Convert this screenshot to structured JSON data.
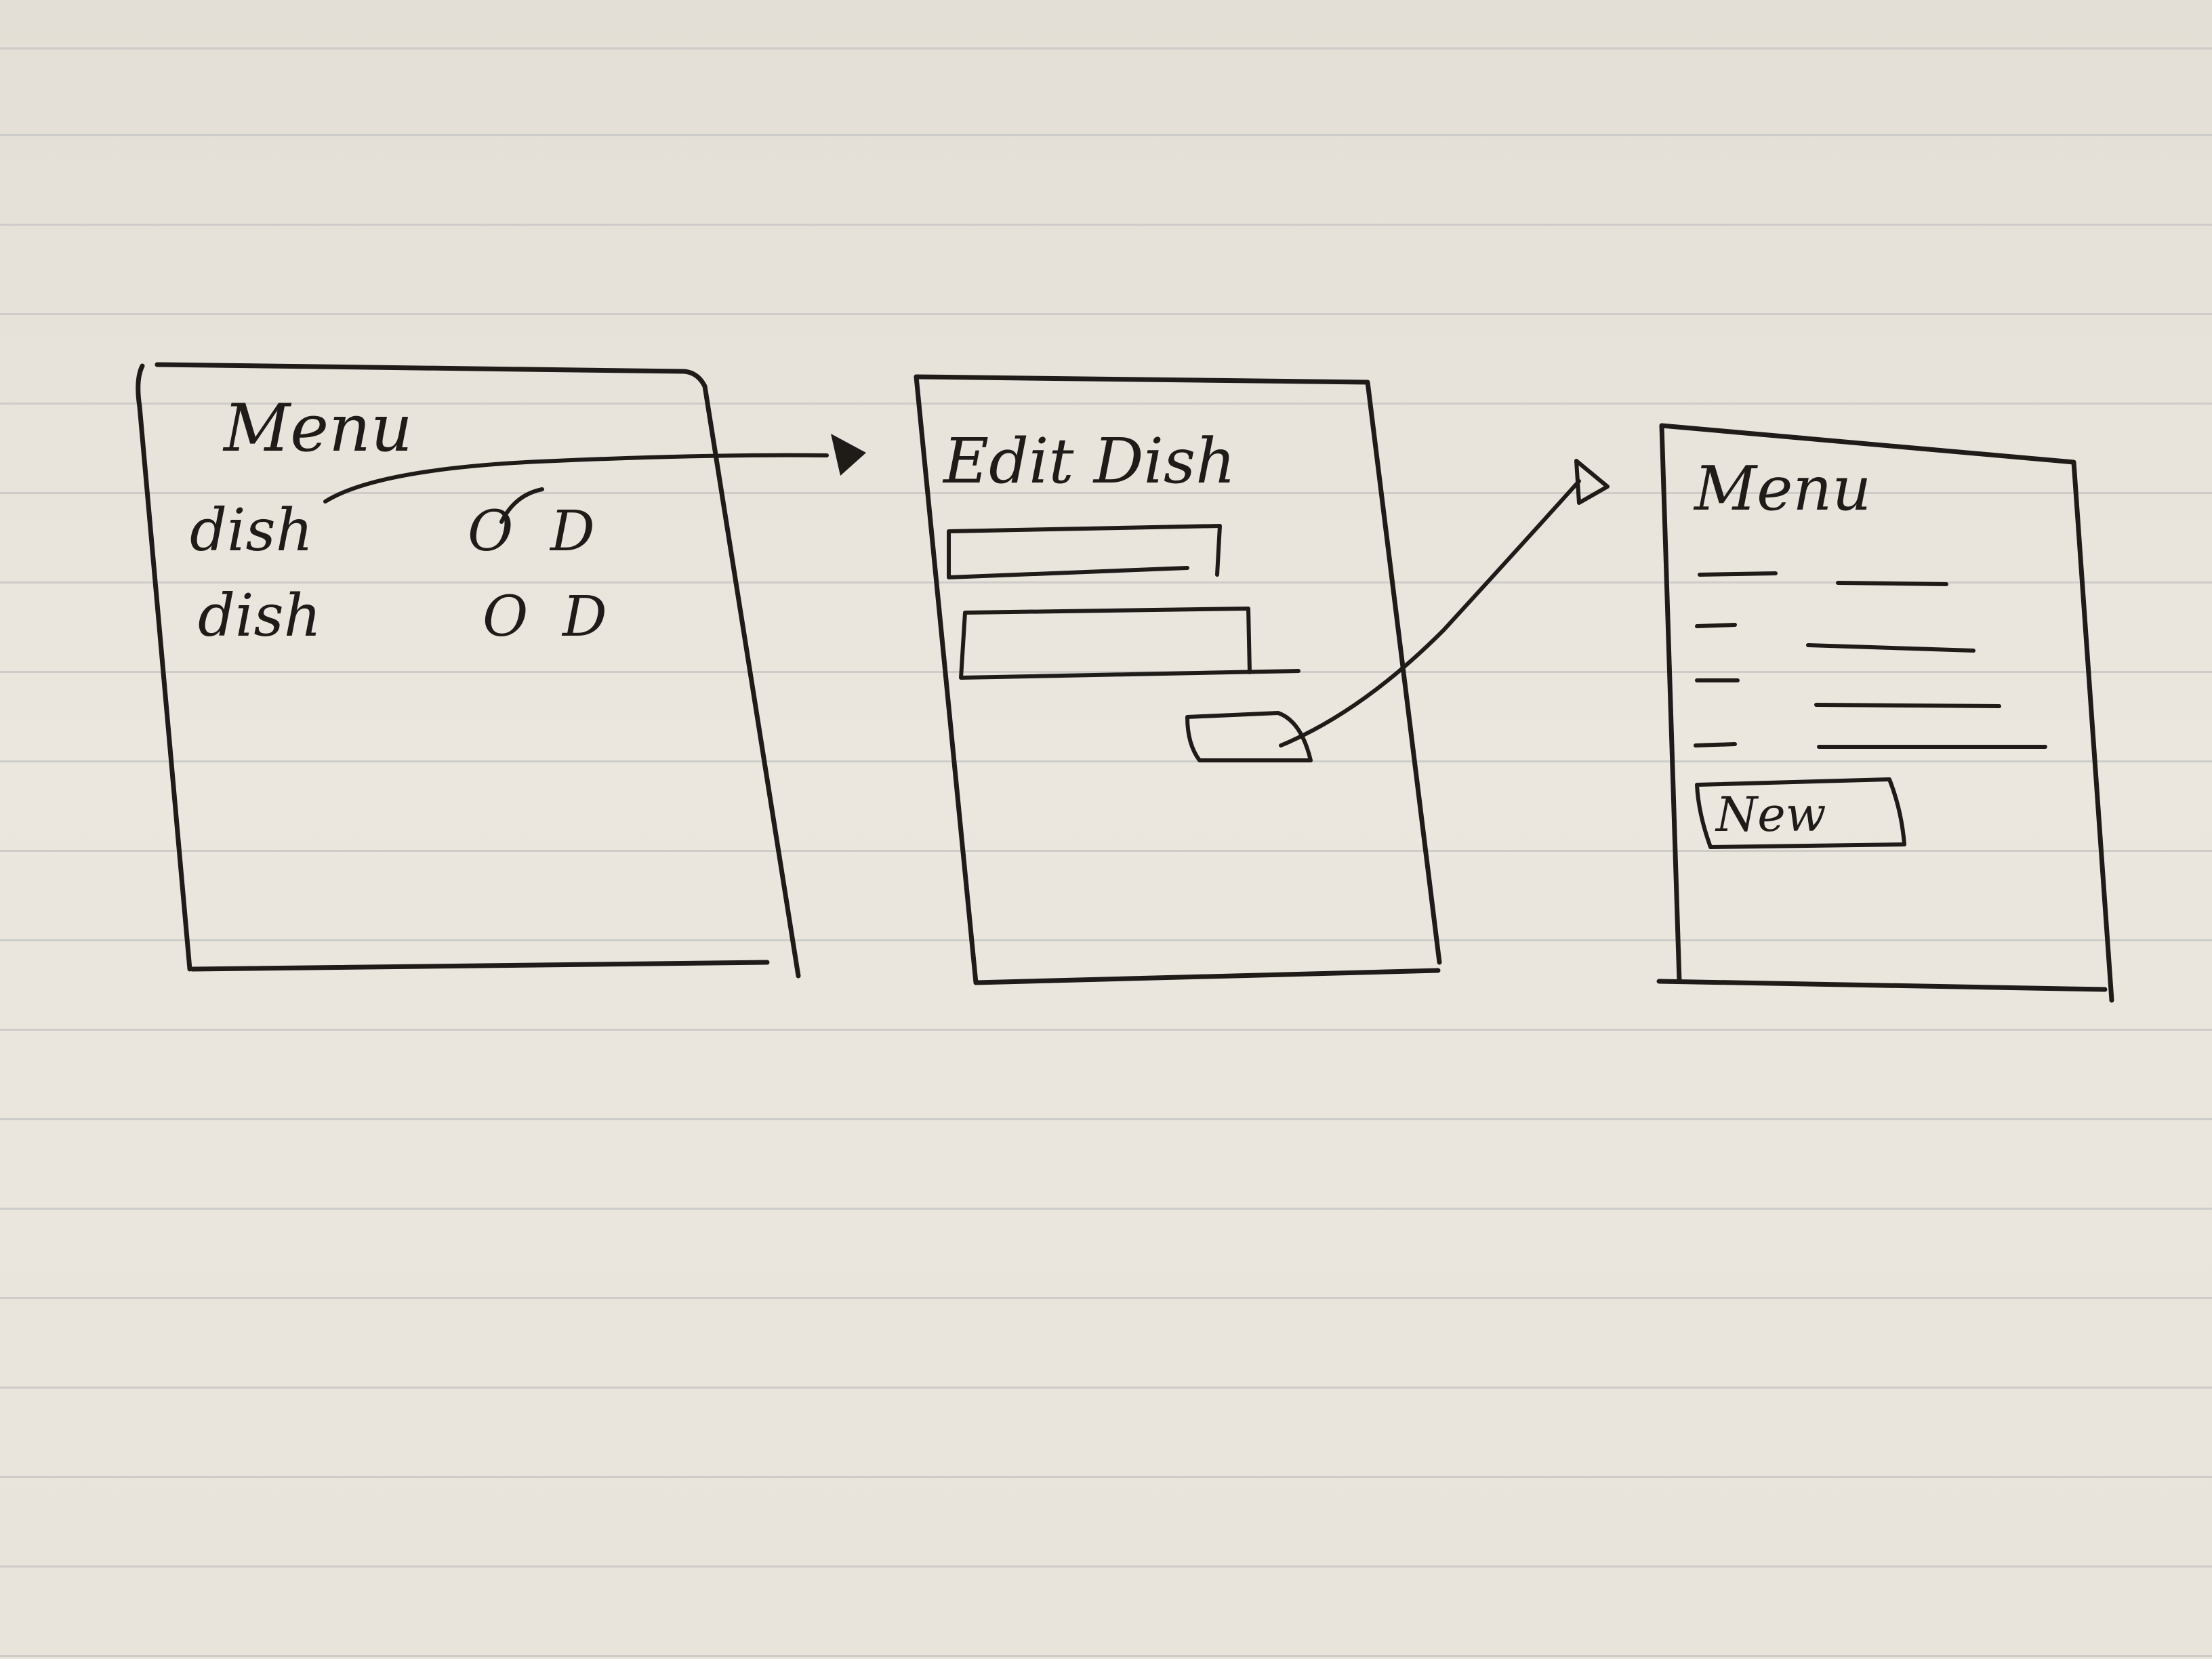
{
  "screens": [
    {
      "title": "Menu",
      "rows": [
        {
          "label": "dish",
          "actions": [
            "O",
            "D"
          ]
        },
        {
          "label": "dish",
          "actions": [
            "O",
            "D"
          ]
        }
      ]
    },
    {
      "title": "Edit Dish",
      "fields": 2,
      "has_button": true
    },
    {
      "title": "Menu",
      "list_rows": 4,
      "button_label": "New"
    }
  ],
  "flow": [
    {
      "from": "Menu (dish row)",
      "to": "Edit Dish"
    },
    {
      "from": "Edit Dish (button)",
      "to": "Menu"
    }
  ],
  "ink_color": "#1e1b18",
  "paper_color": "#e6e2da",
  "rule_color": "#c9c7c6"
}
